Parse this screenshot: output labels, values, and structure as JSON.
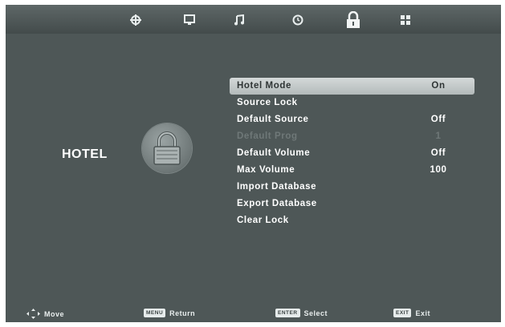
{
  "tabs": [
    {
      "icon": "picture-icon"
    },
    {
      "icon": "screen-icon"
    },
    {
      "icon": "music-note-icon"
    },
    {
      "icon": "clock-icon"
    },
    {
      "icon": "lock-icon"
    },
    {
      "icon": "grid-icon"
    }
  ],
  "section": {
    "title": "HOTEL",
    "icon": "padlock-icon"
  },
  "menu": [
    {
      "label": "Hotel Mode",
      "value": "On"
    },
    {
      "label": "Source Lock",
      "value": ""
    },
    {
      "label": "Default Source",
      "value": "Off"
    },
    {
      "label": "Default Prog",
      "value": "1"
    },
    {
      "label": "Default Volume",
      "value": "Off"
    },
    {
      "label": "Max Volume",
      "value": "100"
    },
    {
      "label": "Import Database",
      "value": ""
    },
    {
      "label": "Export Database",
      "value": ""
    },
    {
      "label": "Clear Lock",
      "value": ""
    }
  ],
  "footer": {
    "move": {
      "label": "Move",
      "icon": "arrows-icon"
    },
    "return": {
      "key": "MENU",
      "label": "Return"
    },
    "select": {
      "key": "ENTER",
      "label": "Select"
    },
    "exit": {
      "key": "EXIT",
      "label": "Exit"
    }
  }
}
